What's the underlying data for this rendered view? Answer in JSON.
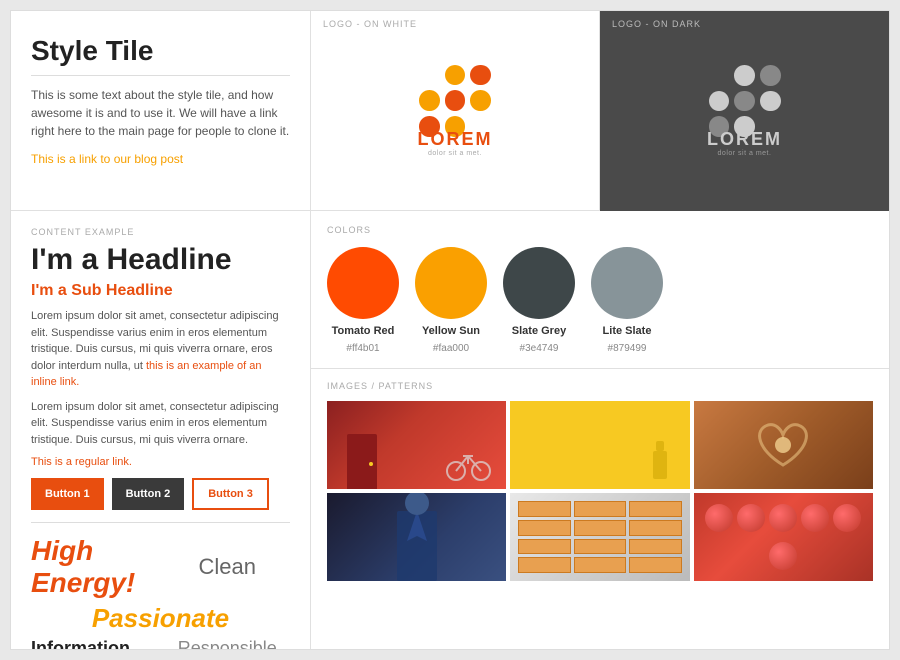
{
  "page": {
    "title": "Style Tile"
  },
  "top_left": {
    "title": "Style Tile",
    "description": "This is some text about the style tile, and how awesome it is and to use it. We will have a link right here to the main page for people to clone it.",
    "link_text": "This is a link to our blog post"
  },
  "logo_on_white": {
    "label": "LOGO - ON WHITE",
    "logo_text": "LOREM",
    "logo_subtext": "dolor sit a met."
  },
  "logo_on_dark": {
    "label": "LOGO - ON DARK",
    "logo_text": "LOREM",
    "logo_subtext": "dolor sit a met."
  },
  "content_example": {
    "label": "CONTENT EXAMPLE",
    "headline": "I'm a Headline",
    "subheadline": "I'm a Sub Headline",
    "body1": "Lorem ipsum dolor sit amet, consectetur adipiscing elit. Suspendisse varius enim in eros elementum tristique. Duis cursus, mi quis viverra ornare, eros dolor interdum nulla, ut ",
    "inline_link": "this is an example of an inline link.",
    "body2": "Lorem ipsum dolor sit amet, consectetur adipiscing elit. Suspendisse varius enim in eros elementum tristique. Duis cursus, mi quis viverra ornare.",
    "regular_link": "This is a regular link.",
    "button1": "Button 1",
    "button2": "Button 2",
    "button3": "Button 3"
  },
  "typography": {
    "high_energy": "High Energy!",
    "clean": "Clean",
    "passionate": "Passionate",
    "information": "Information",
    "responsible": "Responsible"
  },
  "colors": {
    "label": "COLORS",
    "items": [
      {
        "name": "Tomato Red",
        "hex": "#ff4b01",
        "hex_display": "#ff4b01",
        "color": "#ff4b01"
      },
      {
        "name": "Yellow Sun",
        "hex": "#faa000",
        "hex_display": "#faa000",
        "color": "#faa000"
      },
      {
        "name": "Slate Grey",
        "hex": "#3e4749",
        "hex_display": "#3e4749",
        "color": "#3e4749"
      },
      {
        "name": "Lite Slate",
        "hex": "#879499",
        "hex_display": "#879499",
        "color": "#879499"
      }
    ]
  },
  "images": {
    "label": "IMAGES / PATTERNS"
  }
}
